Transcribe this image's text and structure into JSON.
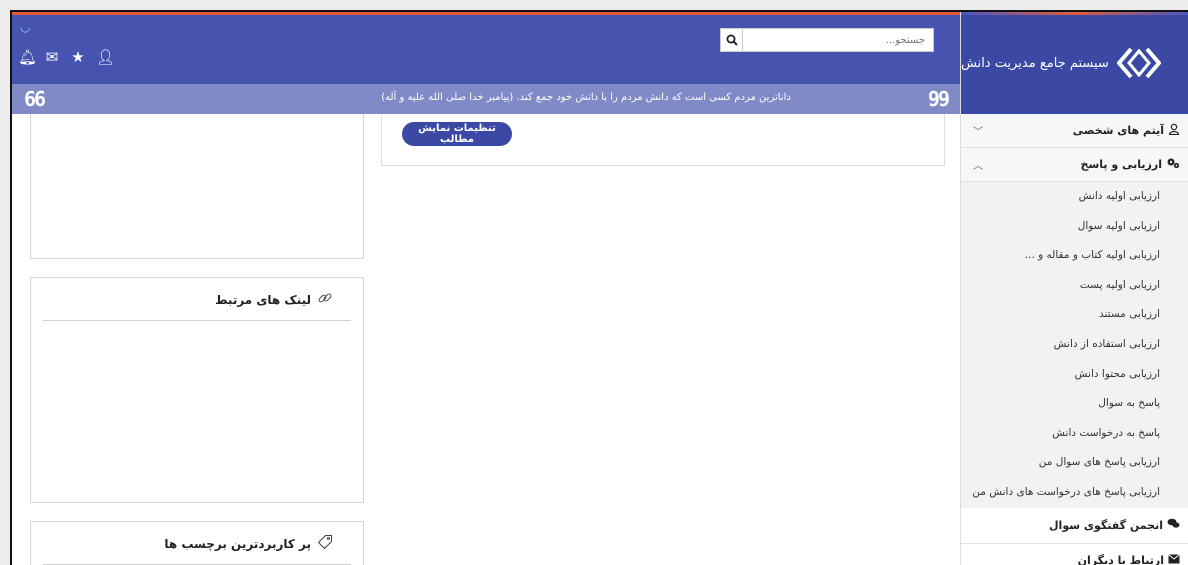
{
  "brand": {
    "title": "سیستم جامع مدیریت دانش"
  },
  "search": {
    "placeholder": "جستجو..."
  },
  "top_icons": [
    "user-icon",
    "star-icon",
    "mail-icon",
    "bell-icon"
  ],
  "quote": {
    "text": "داناترین مردم کسی است که دانش مردم را با دانش خود جمع کند. (پیامبر خدا صلی الله علیه و آله)",
    "open_mark": "99",
    "close_mark": "66"
  },
  "content": {
    "settings_button": "تنظیمات نمایش مطالب"
  },
  "panels": {
    "links_title": "لینک های مرتبط",
    "tags_title": "پر کاربردترین برچسب ها"
  },
  "sidebar": {
    "personal_items": "آیتم های شخصی",
    "evaluation": "ارزیابی و پاسخ",
    "sub_items": [
      "ارزیابی اولیه دانش",
      "ارزیابی اولیه سوال",
      "ارزیابی اولیه کتاب و مقاله و ...",
      "ارزیابی اولیه پست",
      "ارزیابی مستند",
      "ارزیابی استفاده از دانش",
      "ارزیابی محتوا دانش",
      "پاسخ به سوال",
      "پاسخ به درخواست دانش",
      "ارزیابی پاسخ های سوال من",
      "ارزیابی پاسخ های درخواست های دانش من"
    ],
    "forum": "انجمن گفتگوی سوال",
    "communication": "ارتباط با دیگران"
  },
  "colors": {
    "primary": "#4654b0",
    "brand": "#3b48a4",
    "quote_bar": "#7f8ac6",
    "accent": "#e05a3a"
  }
}
